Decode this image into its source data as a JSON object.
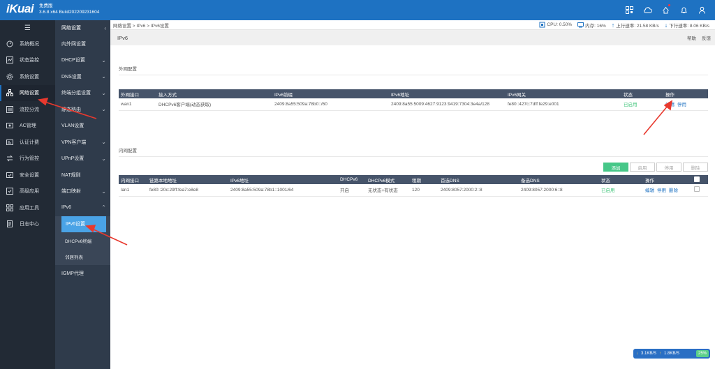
{
  "app": {
    "logo": "iKuai",
    "edition": "免费版",
    "build": "3.6.8 x64 Build202209231604"
  },
  "sidebar1": {
    "items": [
      {
        "label": "系统概况",
        "icon": "gauge-icon"
      },
      {
        "label": "状态监控",
        "icon": "monitor-chart-icon"
      },
      {
        "label": "系统设置",
        "icon": "gear-icon"
      },
      {
        "label": "网络设置",
        "icon": "network-icon"
      },
      {
        "label": "流控分流",
        "icon": "flow-control-icon"
      },
      {
        "label": "AC管理",
        "icon": "ac-management-icon"
      },
      {
        "label": "认证计费",
        "icon": "auth-billing-icon"
      },
      {
        "label": "行为管控",
        "icon": "behavior-control-icon"
      },
      {
        "label": "安全设置",
        "icon": "security-icon"
      },
      {
        "label": "高级应用",
        "icon": "advanced-app-icon"
      },
      {
        "label": "应用工具",
        "icon": "app-tools-icon"
      },
      {
        "label": "日志中心",
        "icon": "log-icon"
      }
    ]
  },
  "sidebar2": {
    "title": "网络设置",
    "items": [
      {
        "label": "内外网设置"
      },
      {
        "label": "DHCP设置"
      },
      {
        "label": "DNS设置"
      },
      {
        "label": "终端分组设置"
      },
      {
        "label": "静态路由"
      },
      {
        "label": "VLAN设置"
      },
      {
        "label": "VPN客户端"
      },
      {
        "label": "UPnP设置"
      },
      {
        "label": "NAT规则"
      },
      {
        "label": "端口映射"
      },
      {
        "label": "IPv6"
      },
      {
        "label": "IPv6设置"
      },
      {
        "label": "DHCPv6终端"
      },
      {
        "label": "邻居列表"
      },
      {
        "label": "IGMP代理"
      }
    ]
  },
  "breadcrumb": "网络设置 > IPv6 > IPv6设置",
  "stats": {
    "cpu": "CPU: 0.50%",
    "mem": "内存: 16%",
    "up": "上行速率: 21.58 KB/s",
    "down": "下行速率: 8.06 KB/s"
  },
  "page": {
    "title": "IPv6",
    "help": "帮助",
    "feedback": "反馈"
  },
  "wan": {
    "title": "外网配置",
    "headers": [
      "外网接口",
      "接入方式",
      "IPv6前缀",
      "IPv6地址",
      "IPv6网关",
      "状态",
      "操作"
    ],
    "rows": [
      {
        "iface": "wan1",
        "mode": "DHCPv6客户端(动态获取)",
        "prefix": "2409:8a55:509a:78b0::/60",
        "addr": "2409:8a55:5009:4627:9123:9419:7304:3e4a/128",
        "gw": "fe80::427c:7dff:fe29:e001",
        "status": "已启用",
        "edit": "编辑",
        "disable": "停用"
      }
    ]
  },
  "lan": {
    "title": "内网配置",
    "buttons": {
      "add": "添加",
      "enable": "启用",
      "disable": "停用",
      "delete": "删除"
    },
    "headers": [
      "内网接口",
      "链路本地地址",
      "IPv6地址",
      "DHCPv6",
      "DHCPv6模式",
      "租期",
      "首选DNS",
      "备选DNS",
      "状态",
      "操作"
    ],
    "rows": [
      {
        "iface": "lan1",
        "link": "fe80::20c:29ff:fea7:e8e8",
        "addr": "2409:8a55:509a:78b1::1001/64",
        "dhcp": "开启",
        "mode": "无状态+有状态",
        "lease": "120",
        "dns1": "2409:8057:2000:2::8",
        "dns2": "2409:8057:2000:6::8",
        "status": "已启用",
        "edit": "编辑",
        "disable": "停用",
        "delete": "删除"
      }
    ]
  },
  "speed": {
    "down": "3.1KB/S",
    "up": "1.8KB/S",
    "pct": "25%"
  },
  "colors": {
    "brand": "#1e72c2",
    "enabled": "#3fc47a",
    "add": "#46c788",
    "annotation": "#e8392e"
  }
}
